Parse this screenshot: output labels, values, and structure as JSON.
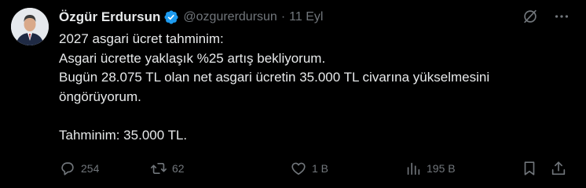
{
  "author": {
    "name": "Özgür Erdursun",
    "handle": "@ozgurerdursun",
    "separator": "·",
    "date": "11 Eyl",
    "verified_color": "#1d9bf0"
  },
  "tweet": {
    "lines": [
      "2027 asgari ücret tahminim:",
      "Asgari ücrette yaklaşık %25 artış bekliyorum.",
      "Bugün 28.075 TL olan net asgari ücretin 35.000 TL civarına yükselmesini",
      "öngörüyorum.",
      "",
      "Tahminim: 35.000 TL."
    ]
  },
  "top_icons": [
    "grok-icon",
    "more-icon"
  ],
  "actions": {
    "reply": {
      "icon": "reply-icon",
      "count": "254"
    },
    "repost": {
      "icon": "repost-icon",
      "count": "62"
    },
    "like": {
      "icon": "heart-icon",
      "count": "1 B"
    },
    "views": {
      "icon": "views-icon",
      "count": "195 B"
    },
    "bookmark": {
      "icon": "bookmark-icon"
    },
    "share": {
      "icon": "share-icon"
    }
  },
  "colors": {
    "background": "#000000",
    "text": "#e7e9ea",
    "muted": "#71767b",
    "accent": "#1d9bf0"
  }
}
